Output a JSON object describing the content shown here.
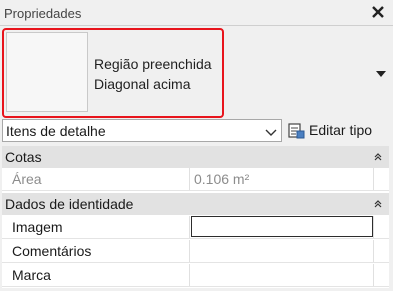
{
  "panel": {
    "title": "Propriedades",
    "close_icon": "close-icon"
  },
  "type_selector": {
    "line1": "Região preenchida",
    "line2": "Diagonal acima",
    "highlight_color": "#e8141c"
  },
  "instance_selector": {
    "value": "Itens de detalhe",
    "edit_type_label": "Editar tipo"
  },
  "groups": [
    {
      "label": "Cotas",
      "rows": [
        {
          "name": "Área",
          "value": "0.106 m²",
          "disabled": true
        }
      ]
    },
    {
      "label": "Dados de identidade",
      "rows": [
        {
          "name": "Imagem",
          "value": ""
        },
        {
          "name": "Comentários",
          "value": ""
        },
        {
          "name": "Marca",
          "value": ""
        }
      ]
    }
  ]
}
